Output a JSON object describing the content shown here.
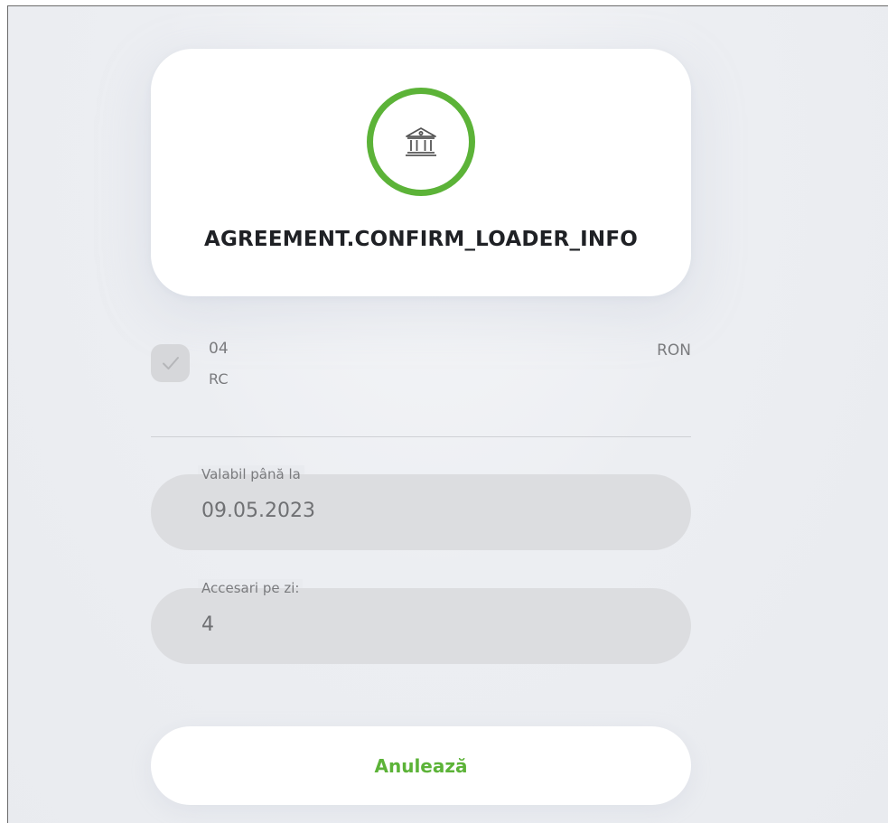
{
  "bank_card": {
    "title": "AGREEMENT.CONFIRM_LOADER_INFO",
    "icon": "bank-icon",
    "ring_color": "#5cb338"
  },
  "account": {
    "number": "04",
    "type": "RC",
    "currency": "RON",
    "checked": true,
    "check_icon": "checkmark-icon"
  },
  "fields": {
    "valid_until": {
      "label": "Valabil până la",
      "value": "09.05.2023"
    },
    "accesses_per_day": {
      "label": "Accesari pe zi:",
      "value": "4"
    }
  },
  "actions": {
    "cancel_label": "Anulează"
  },
  "colors": {
    "accent": "#5cb338",
    "field_bg": "#dcdde0",
    "page_bg": "#e9ebef"
  }
}
